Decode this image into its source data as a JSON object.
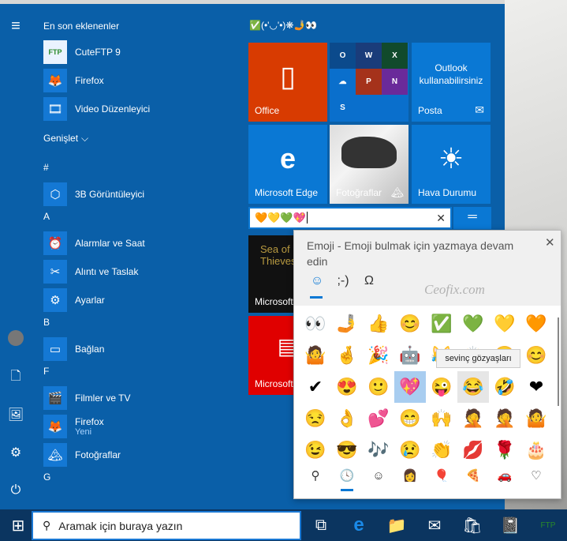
{
  "rail": {
    "icons": [
      "hamburger-menu-icon",
      "user-avatar-icon",
      "document-icon",
      "pictures-icon",
      "settings-icon",
      "power-icon"
    ]
  },
  "apps": {
    "recent_header": "En son eklenenler",
    "recent": [
      {
        "label": "CuteFTP 9",
        "icon": "FTP"
      },
      {
        "label": "Firefox",
        "icon": "🦊"
      },
      {
        "label": "Video Düzenleyici",
        "icon": "🎞"
      }
    ],
    "expand_label": "Genişlet",
    "sections": [
      {
        "letter": "#",
        "items": [
          {
            "label": "3B Görüntüleyici",
            "icon": "⬡"
          }
        ]
      },
      {
        "letter": "A",
        "items": [
          {
            "label": "Alarmlar ve Saat",
            "icon": "⏰"
          },
          {
            "label": "Alıntı ve Taslak",
            "icon": "✂"
          },
          {
            "label": "Ayarlar",
            "icon": "⚙"
          }
        ]
      },
      {
        "letter": "B",
        "items": [
          {
            "label": "Bağlan",
            "icon": "▭"
          }
        ]
      },
      {
        "letter": "F",
        "items": [
          {
            "label": "Filmler ve TV",
            "icon": "🎬"
          },
          {
            "label": "Firefox",
            "icon": "🦊",
            "sub": "Yeni"
          },
          {
            "label": "Fotoğraflar",
            "icon": "🏔"
          }
        ]
      },
      {
        "letter": "G",
        "items": []
      }
    ]
  },
  "tiles": {
    "group_title": "✅(•'◡'•)❋🤳👀",
    "office": "Office",
    "outlook_line1": "Outlook",
    "outlook_line2": "kullanabilirsiniz",
    "posta": "Posta",
    "edge": "Microsoft Edge",
    "photos": "Fotoğraflar",
    "weather": "Hava Durumu",
    "game": "Microsoft",
    "news": "Microsoft",
    "rename_value": "🧡💛💚💖"
  },
  "emoji_panel": {
    "title": "Emoji - Emoji bulmak için yazmaya devam edin",
    "watermark": "Ceofix.com",
    "tabs": [
      "☺",
      ";-)",
      "Ω"
    ],
    "grid": [
      [
        "👀",
        "🤳",
        "👍",
        "😊",
        "✅",
        "💚",
        "💛",
        "🧡"
      ],
      [
        "🤷",
        "🤞",
        "🎉",
        "🤖",
        "😹",
        "🙌",
        "😂",
        "😊"
      ],
      [
        "✔",
        "😍",
        "🙂",
        "💖",
        "😜",
        "😂",
        "🤣",
        "❤"
      ],
      [
        "😒",
        "👌",
        "💕",
        "😁",
        "🙌",
        "🤦",
        "🤦",
        "🤷"
      ],
      [
        "😉",
        "😎",
        "🎶",
        "😢",
        "👏",
        "💋",
        "🌹",
        "🎂"
      ]
    ],
    "selected": "2,3",
    "hovered": "2,5",
    "tooltip": "sevinç gözyaşları",
    "categories": [
      "⚲",
      "🕓",
      "☺",
      "👩",
      "🎈",
      "🍕",
      "🚗",
      "♡"
    ]
  },
  "taskbar": {
    "search_placeholder": "Aramak için buraya yazın",
    "icons": [
      "task-view-icon",
      "edge-icon",
      "file-explorer-icon",
      "mail-icon",
      "store-icon",
      "notepad-icon",
      "cuteftp-icon"
    ]
  }
}
